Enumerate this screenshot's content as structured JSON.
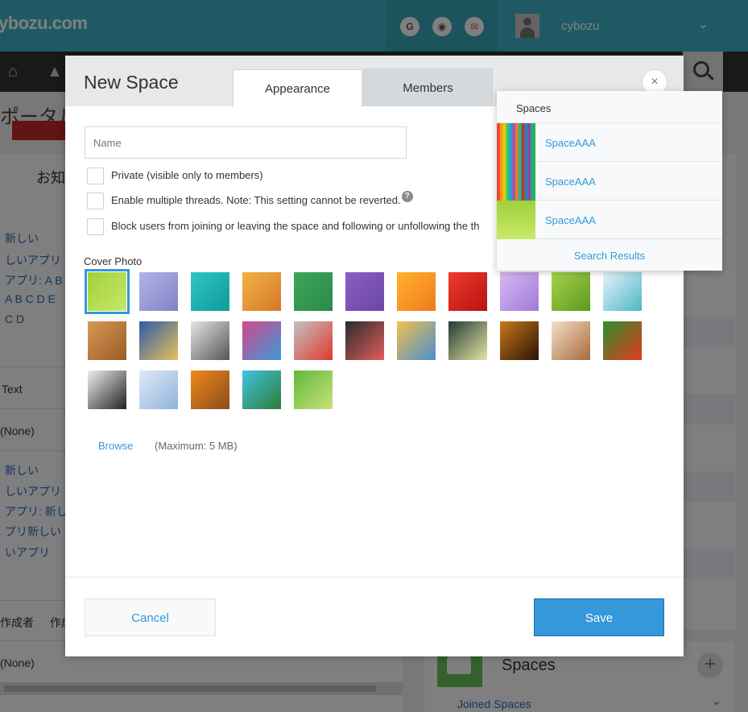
{
  "app": {
    "logo": "ybozu.com",
    "username": "cybozu",
    "header_icons": [
      {
        "name": "google-icon",
        "glyph": "G"
      },
      {
        "name": "circle-icon",
        "glyph": "◉"
      },
      {
        "name": "mail-icon",
        "glyph": "✉"
      }
    ],
    "portal_title": "ポータル",
    "notice_label": "お知",
    "left_links": [
      "新しい",
      "しいアプリ",
      "アプリ: A B",
      "A B C D E",
      "C D"
    ],
    "text_label": "Text",
    "none_label_1": "(None)",
    "left_links_2": [
      "新しい",
      "しいアプリ",
      "アプリ: 新し",
      "プリ新しい",
      "いアプリ"
    ],
    "table_headers": [
      "作成者",
      "作成"
    ],
    "none_label_2": "(None)",
    "spaces_title": "Spaces",
    "joined_spaces": "Joined Spaces"
  },
  "dialog": {
    "title": "New Space",
    "tabs": [
      {
        "label": "Appearance",
        "active": true
      },
      {
        "label": "Members",
        "active": false
      }
    ],
    "close_glyph": "×",
    "name_placeholder": "Name",
    "name_value": "",
    "checkboxes": [
      {
        "label": "Private (visible only to members)",
        "checked": false
      },
      {
        "label": "Enable multiple threads. Note: This setting cannot be reverted.",
        "checked": false,
        "help": "?"
      },
      {
        "label": "Block users from joining or leaving the space and following or unfollowing the th",
        "checked": false
      }
    ],
    "cover_photo_label": "Cover Photo",
    "cover_photos": [
      {
        "name": "cover-green-lime",
        "selected": true,
        "colors": [
          "#9fd13a",
          "#c9e86a"
        ]
      },
      {
        "name": "cover-lavender-blur",
        "selected": false,
        "colors": [
          "#b4b2e6",
          "#7f84c8"
        ]
      },
      {
        "name": "cover-teal-paint",
        "selected": false,
        "colors": [
          "#2ec6c4",
          "#0f9a9a"
        ]
      },
      {
        "name": "cover-orange-texture",
        "selected": false,
        "colors": [
          "#f0b344",
          "#d8772a"
        ]
      },
      {
        "name": "cover-green-fabric",
        "selected": false,
        "colors": [
          "#3fa55b",
          "#2b8a48"
        ]
      },
      {
        "name": "cover-purple-fabric",
        "selected": false,
        "colors": [
          "#8a5fc2",
          "#6b46a8"
        ]
      },
      {
        "name": "cover-orange-flower",
        "selected": false,
        "colors": [
          "#ffb22e",
          "#f07a1d"
        ]
      },
      {
        "name": "cover-red-flower",
        "selected": false,
        "colors": [
          "#ef3a2e",
          "#b5130f"
        ]
      },
      {
        "name": "cover-purple-flower",
        "selected": false,
        "colors": [
          "#d9b9f2",
          "#a07ad8"
        ]
      },
      {
        "name": "cover-green-leaf",
        "selected": false,
        "colors": [
          "#a6d34a",
          "#5b9a1d"
        ]
      },
      {
        "name": "cover-cyan-cubes",
        "selected": false,
        "colors": [
          "#e7f4f7",
          "#4db6c9"
        ]
      },
      {
        "name": "cover-weave",
        "selected": false,
        "colors": [
          "#d69a56",
          "#9a5a25"
        ]
      },
      {
        "name": "cover-tiles",
        "selected": false,
        "colors": [
          "#2a5ca8",
          "#e9c05a"
        ]
      },
      {
        "name": "cover-compass",
        "selected": false,
        "colors": [
          "#e6e6e6",
          "#555555"
        ]
      },
      {
        "name": "cover-books",
        "selected": false,
        "colors": [
          "#d6458b",
          "#3b9bd6"
        ]
      },
      {
        "name": "cover-gears",
        "selected": false,
        "colors": [
          "#c2c2c2",
          "#e03a2e"
        ]
      },
      {
        "name": "cover-chalkboard",
        "selected": false,
        "colors": [
          "#2b2b2b",
          "#e25d5d"
        ]
      },
      {
        "name": "cover-pencils",
        "selected": false,
        "colors": [
          "#f2c14b",
          "#4a8ed1"
        ]
      },
      {
        "name": "cover-bulbs",
        "selected": false,
        "colors": [
          "#1f3d33",
          "#e8e2a4"
        ]
      },
      {
        "name": "cover-bokeh",
        "selected": false,
        "colors": [
          "#c87a18",
          "#2a1204"
        ]
      },
      {
        "name": "cover-latte",
        "selected": false,
        "colors": [
          "#f3e1c8",
          "#a8683a"
        ]
      },
      {
        "name": "cover-vegetables",
        "selected": false,
        "colors": [
          "#2f8f2f",
          "#e03a1e"
        ]
      },
      {
        "name": "cover-cat",
        "selected": false,
        "colors": [
          "#f0f0f0",
          "#222222"
        ]
      },
      {
        "name": "cover-snow",
        "selected": false,
        "colors": [
          "#dfeaf7",
          "#8fb3dc"
        ]
      },
      {
        "name": "cover-pumpkins",
        "selected": false,
        "colors": [
          "#f08a1a",
          "#8b4a1c"
        ]
      },
      {
        "name": "cover-beach",
        "selected": false,
        "colors": [
          "#3fc3e6",
          "#2e7d32"
        ]
      },
      {
        "name": "cover-bamboo",
        "selected": false,
        "colors": [
          "#5fb83a",
          "#c9e27a"
        ]
      }
    ],
    "browse_label": "Browse",
    "max_size_label": "(Maximum: 5 MB)",
    "cancel_label": "Cancel",
    "save_label": "Save",
    "accent_color": "#3498db"
  },
  "search_dropdown": {
    "header": "Spaces",
    "results": [
      {
        "name": "SpaceAAA",
        "thumb": "pencils"
      },
      {
        "name": "SpaceAAA",
        "thumb": "pencils"
      },
      {
        "name": "SpaceAAA",
        "thumb": "green"
      }
    ],
    "footer": "Search Results"
  }
}
